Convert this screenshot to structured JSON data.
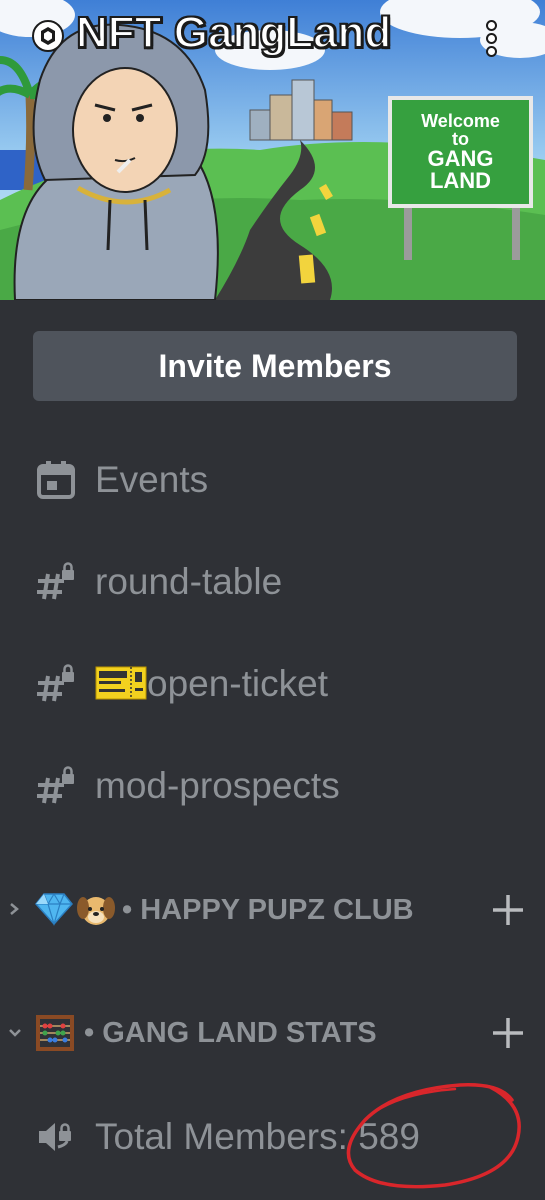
{
  "server": {
    "name": "NFT GangLand",
    "banner_sign": [
      "Welcome",
      "to",
      "GANG",
      "LAND"
    ]
  },
  "invite_button": {
    "label": "Invite Members"
  },
  "channels": [
    {
      "name": "Events",
      "icon": "calendar-icon"
    },
    {
      "name": "round-table",
      "icon": "locked-text-channel-icon"
    },
    {
      "name": "open-ticket",
      "icon": "locked-text-channel-icon",
      "emoji": "ticket-emoji"
    },
    {
      "name": "mod-prospects",
      "icon": "locked-text-channel-icon"
    }
  ],
  "categories": [
    {
      "label": "• HAPPY PUPZ CLUB",
      "emojis": [
        "💎",
        "🐶"
      ],
      "collapsed": true
    },
    {
      "label": "• GANG LAND STATS",
      "emojis": [
        "🧮"
      ],
      "collapsed": false
    }
  ],
  "stats_channel": {
    "name": "Total Members: 589",
    "icon": "locked-voice-channel-icon"
  },
  "colors": {
    "background": "#2f3136",
    "button": "#4f545c",
    "muted_text": "#8e9297",
    "annotation": "#d9262b"
  }
}
